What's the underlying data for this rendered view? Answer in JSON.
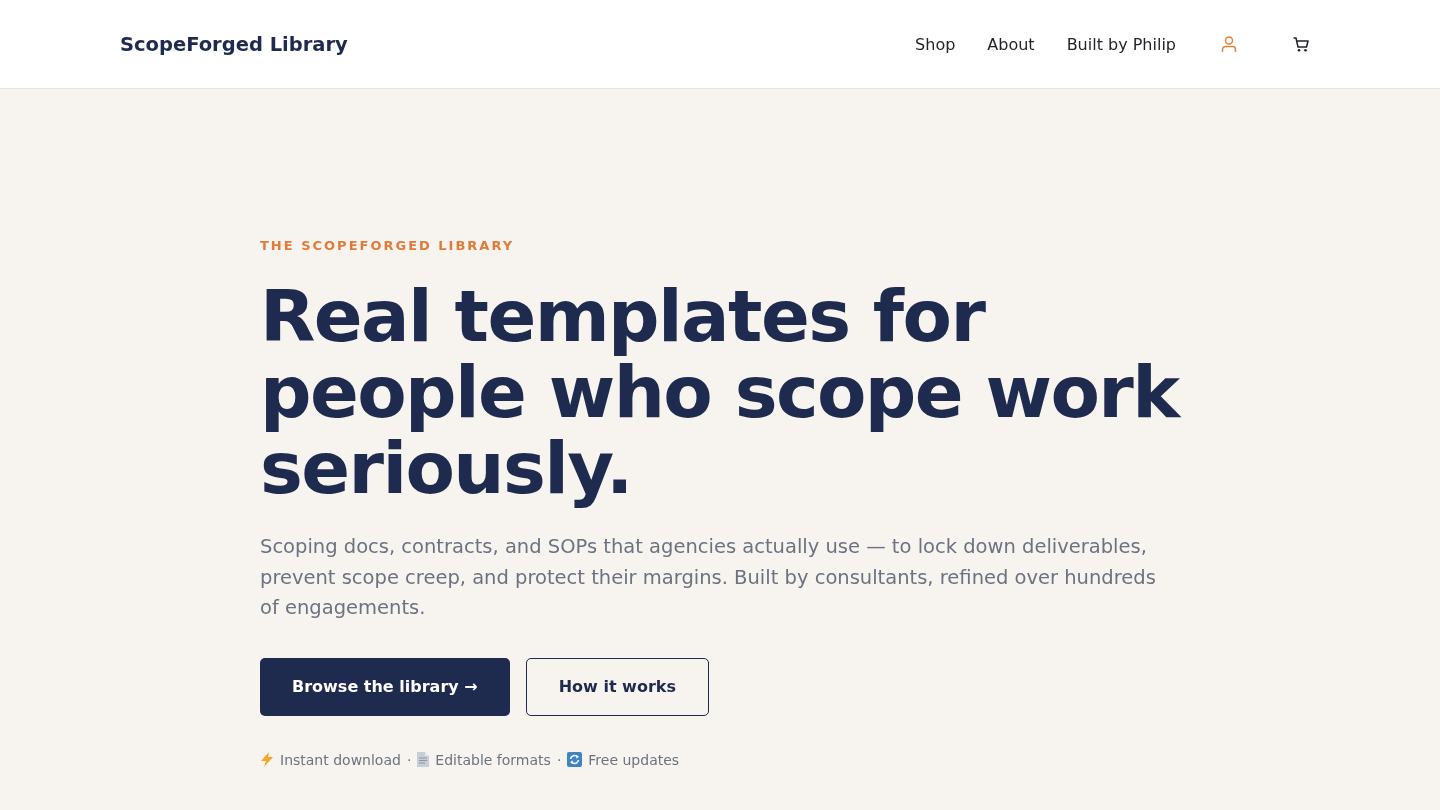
{
  "header": {
    "logo": "ScopeForged Library",
    "nav": [
      {
        "label": "Shop"
      },
      {
        "label": "About"
      },
      {
        "label": "Built by Philip"
      }
    ]
  },
  "hero": {
    "eyebrow": "THE SCOPEFORGED LIBRARY",
    "heading": "Real templates for people who scope work seriously.",
    "description": "Scoping docs, contracts, and SOPs that agencies actually use — to lock down deliverables, prevent scope creep, and protect their margins. Built by consultants, refined over hundreds of engagements.",
    "buttons": [
      {
        "label": "Browse the library →",
        "kind": "primary"
      },
      {
        "label": "How it works",
        "kind": "secondary"
      }
    ],
    "features": [
      {
        "text": "Instant download",
        "separator": "·"
      },
      {
        "text": "Editable formats",
        "separator": "·"
      },
      {
        "text": "Free updates"
      }
    ]
  }
}
